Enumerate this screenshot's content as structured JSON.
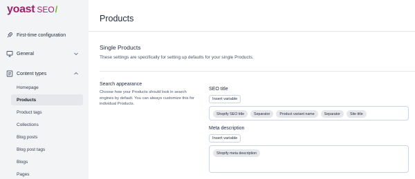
{
  "logo": {
    "brand": "yoast",
    "product": "SEO",
    "slash": "/"
  },
  "colors": {
    "brand": "#a61e69",
    "accent_green": "#77b227",
    "active_bg": "#e5e7eb"
  },
  "sidebar": {
    "items": [
      {
        "label": "First-time configuration",
        "icon": "rocket-icon",
        "expandable": false
      },
      {
        "label": "General",
        "icon": "monitor-icon",
        "expandable": true,
        "expanded": false
      },
      {
        "label": "Content types",
        "icon": "document-list-icon",
        "expandable": true,
        "expanded": true
      }
    ],
    "content_types": [
      {
        "label": "Homepage",
        "active": false
      },
      {
        "label": "Products",
        "active": true
      },
      {
        "label": "Product tags",
        "active": false
      },
      {
        "label": "Collections",
        "active": false
      },
      {
        "label": "Blog posts",
        "active": false
      },
      {
        "label": "Blog post tags",
        "active": false
      },
      {
        "label": "Blogs",
        "active": false
      },
      {
        "label": "Pages",
        "active": false
      }
    ]
  },
  "main": {
    "title": "Products",
    "section": {
      "title": "Single Products",
      "description": "These settings are specifically for setting up defaults for your single Products."
    },
    "search_appearance": {
      "title": "Search appearance",
      "description": "Choose how your Products should look in search engines by default. You can always customize this for individual Products."
    },
    "seo_title": {
      "label": "SEO title",
      "insert_label": "Insert variable",
      "chips": [
        "Shopify SEO title",
        "Separator",
        "Product variant name",
        "Separator",
        "Site title"
      ]
    },
    "meta_description": {
      "label": "Meta description",
      "insert_label": "Insert variable",
      "chips": [
        "Shopify meta description"
      ]
    }
  }
}
